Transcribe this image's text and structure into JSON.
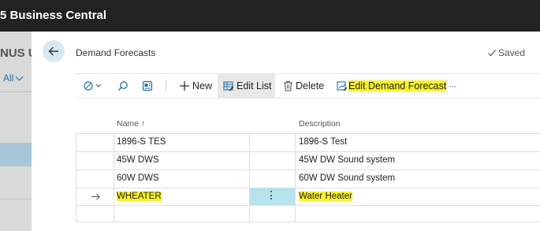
{
  "app": {
    "title": "5 Business Central"
  },
  "left_pane": {
    "title": "NUS U",
    "filter_label": "All"
  },
  "page": {
    "title": "Demand Forecasts",
    "status": "Saved"
  },
  "toolbar": {
    "new_label": "New",
    "edit_list_label": "Edit List",
    "delete_label": "Delete",
    "edit_forecast_label": "Edit Demand Forecast",
    "more_label": "···"
  },
  "columns": {
    "name": "Name",
    "name_sort_indicator": "↑",
    "description": "Description"
  },
  "rows": [
    {
      "name": "1896-S TES",
      "description": "1896-S Test"
    },
    {
      "name": "45W DWS",
      "description": "45W DW Sound system"
    },
    {
      "name": "60W DWS",
      "description": "60W DW Sound system"
    },
    {
      "name": "WHEATER",
      "description": "Water Heater",
      "selected": true
    }
  ],
  "colors": {
    "topbar": "#222222",
    "accent": "#1f6fa8",
    "highlight": "#f8f12a",
    "selected_cell": "#b8e2ec"
  },
  "icons": [
    "back-arrow-icon",
    "checkmark-icon",
    "filter-pane-icon",
    "search-icon",
    "share-icon",
    "plus-icon",
    "edit-list-icon",
    "delete-icon",
    "edit-forecast-icon",
    "more-icon",
    "row-selection-arrow-icon",
    "row-actions-icon"
  ]
}
